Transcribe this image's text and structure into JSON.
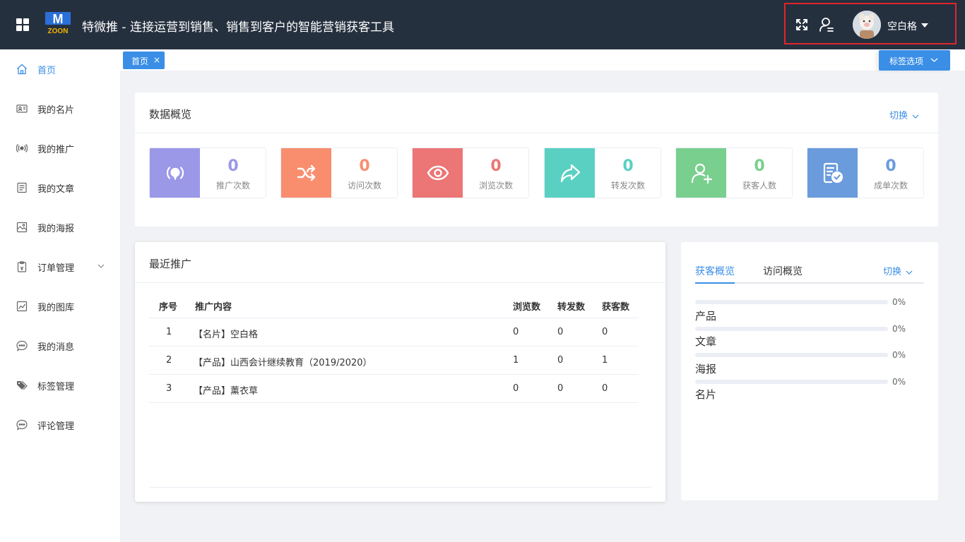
{
  "header": {
    "title": "特微推 - 连接运营到销售、销售到客户的智能营销获客工具",
    "logo_text_top": "M",
    "logo_text_bottom": "ZOON",
    "user_name": "空白格"
  },
  "sidebar": {
    "items": [
      {
        "label": "首页",
        "icon": "home-icon",
        "active": true
      },
      {
        "label": "我的名片",
        "icon": "id-card-icon"
      },
      {
        "label": "我的推广",
        "icon": "broadcast-icon"
      },
      {
        "label": "我的文章",
        "icon": "article-icon"
      },
      {
        "label": "我的海报",
        "icon": "image-icon"
      },
      {
        "label": "订单管理",
        "icon": "order-icon",
        "has_submenu": true
      },
      {
        "label": "我的图库",
        "icon": "chart-icon"
      },
      {
        "label": "我的消息",
        "icon": "message-icon"
      },
      {
        "label": "标签管理",
        "icon": "tag-icon"
      },
      {
        "label": "评论管理",
        "icon": "comment-icon"
      }
    ]
  },
  "tabs": {
    "home_label": "首页",
    "close_glyph": "×",
    "tags_option_label": "标签选项"
  },
  "overview": {
    "title": "数据概览",
    "switch_label": "切换",
    "stats": [
      {
        "value": "0",
        "label": "推广次数",
        "color": "#9b98e8",
        "icon": "broadcast-icon"
      },
      {
        "value": "0",
        "label": "访问次数",
        "color": "#f98e6f",
        "icon": "shuffle-icon"
      },
      {
        "value": "0",
        "label": "浏览次数",
        "color": "#ec7575",
        "icon": "eye-icon"
      },
      {
        "value": "0",
        "label": "转发次数",
        "color": "#5ad0c3",
        "icon": "share-icon"
      },
      {
        "value": "0",
        "label": "获客人数",
        "color": "#79cf8e",
        "icon": "user-add-icon"
      },
      {
        "value": "0",
        "label": "成单次数",
        "color": "#6a9bdc",
        "icon": "order-check-icon"
      }
    ]
  },
  "recent": {
    "title": "最近推广",
    "columns": [
      "序号",
      "推广内容",
      "浏览数",
      "转发数",
      "获客数"
    ],
    "rows": [
      [
        "1",
        "【名片】空白格",
        "0",
        "0",
        "0"
      ],
      [
        "2",
        "【产品】山西会计继续教育（2019/2020）",
        "1",
        "0",
        "1"
      ],
      [
        "3",
        "【产品】薰衣草",
        "0",
        "0",
        "0"
      ]
    ]
  },
  "acquire": {
    "tabs": [
      "获客概览",
      "访问概览"
    ],
    "switch_label": "切换",
    "items": [
      {
        "label": "产品",
        "percent": "0%",
        "value": 0
      },
      {
        "label": "文章",
        "percent": "0%",
        "value": 0
      },
      {
        "label": "海报",
        "percent": "0%",
        "value": 0
      },
      {
        "label": "名片",
        "percent": "0%",
        "value": 0
      }
    ]
  },
  "colors": {
    "header_bg": "#25303f",
    "accent": "#3a8ee6",
    "highlight_border": "#e0252b"
  }
}
